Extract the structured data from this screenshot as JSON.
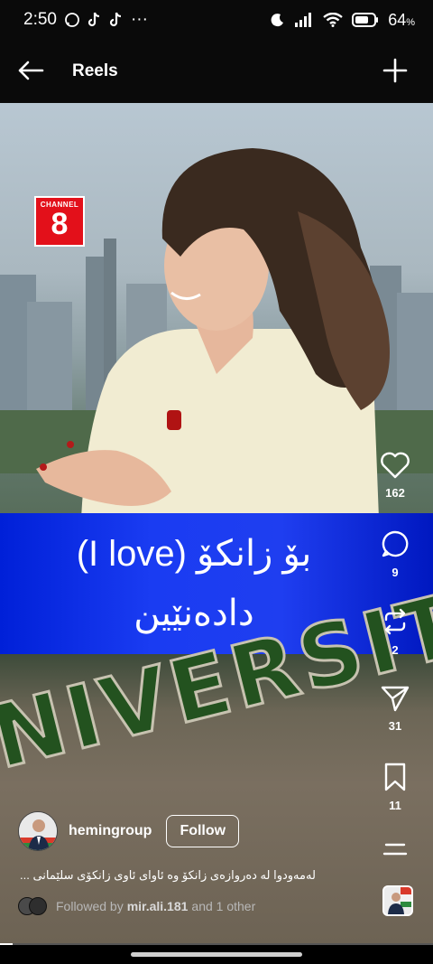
{
  "status_bar": {
    "time": "2:50",
    "more": "···",
    "battery": "64",
    "battery_unit": "%"
  },
  "app_bar": {
    "title": "Reels"
  },
  "video": {
    "channel_logo_top": "CHANNEL",
    "channel_logo_number": "8",
    "caption_line1": "بۆ زانکۆ (I love)",
    "caption_line2": "دادەنێین",
    "field_text": "NIVERSITY"
  },
  "rail": {
    "like_count": "162",
    "comment_count": "9",
    "repost_count": "2",
    "share_count": "31",
    "save_count": "11"
  },
  "post": {
    "username": "hemingroup",
    "follow_label": "Follow",
    "caption": "لەمەودوا لە دەروازەی زانکۆ وە ئاوای ئاوی زانکۆی سلێمانی ...",
    "followed_prefix": "Followed by",
    "followed_name": "mir.ali.181",
    "followed_suffix": "and 1 other"
  },
  "progress_fraction": 0.03,
  "colors": {
    "caption_band": "#1f3ef0",
    "channel_red": "#e3101a"
  }
}
